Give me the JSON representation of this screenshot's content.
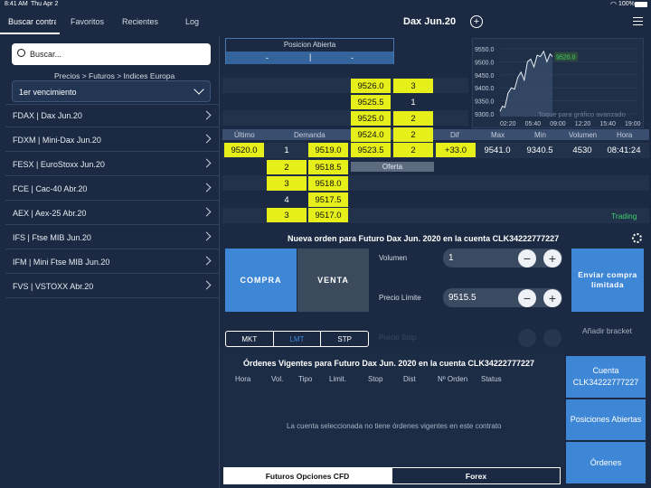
{
  "status": {
    "time": "8:41 AM",
    "date": "Thu Apr 2",
    "battery": "100%"
  },
  "tabs": [
    {
      "label": "Buscar contrat"
    },
    {
      "label": "Favoritos"
    },
    {
      "label": "Recientes"
    },
    {
      "label": "Log"
    }
  ],
  "header": {
    "title": "Dax Jun.20"
  },
  "search": {
    "placeholder": "Buscar..."
  },
  "breadcrumb": "Precios > Futuros > Indices Europa",
  "expiry": {
    "selected": "1er vencimiento"
  },
  "contracts": [
    {
      "label": "FDAX | Dax Jun.20"
    },
    {
      "label": "FDXM | Mini-Dax Jun.20"
    },
    {
      "label": "FESX | EuroStoxx Jun.20"
    },
    {
      "label": "FCE | Cac-40 Abr.20"
    },
    {
      "label": "AEX | Aex-25 Abr.20"
    },
    {
      "label": "IFS | Ftse MIB Jun.20"
    },
    {
      "label": "IFM | Mini Ftse MIB Jun.20"
    },
    {
      "label": "FVS | VSTOXX Abr.20"
    }
  ],
  "position": {
    "title": "Posicion Abierta",
    "left": "-",
    "mid": "|",
    "right": "-"
  },
  "book": {
    "asks": [
      {
        "price": "9526.0",
        "qty": "3"
      },
      {
        "price": "9525.5",
        "qty": "1"
      },
      {
        "price": "9525.0",
        "qty": "2"
      },
      {
        "price": "9524.0",
        "qty": "2"
      },
      {
        "price": "9523.5",
        "qty": "2"
      }
    ],
    "bids": [
      {
        "qty": "1",
        "price": "9519.0"
      },
      {
        "qty": "2",
        "price": "9518.5"
      },
      {
        "qty": "3",
        "price": "9518.0"
      },
      {
        "qty": "4",
        "price": "9517.5"
      },
      {
        "qty": "3",
        "price": "9517.0"
      }
    ],
    "ask_label": "Oferta",
    "headers": {
      "ultimo": "Último",
      "demanda": "Demanda",
      "dif": "Dif",
      "max": "Max",
      "min": "Min",
      "volumen": "Volumen",
      "hora": "Hora"
    },
    "values": {
      "ultimo": "9520.0",
      "dif": "+33.0",
      "max": "9541.0",
      "min": "9340.5",
      "volumen": "4530",
      "hora": "08:41:24"
    },
    "status": "Trading"
  },
  "chart_data": {
    "type": "line",
    "x_ticks": [
      "02:20",
      "05:40",
      "09:00",
      "12:20",
      "15:40",
      "19:00"
    ],
    "y_ticks": [
      "9550.0",
      "9500.0",
      "9450.0",
      "9400.0",
      "9350.0",
      "9300.0"
    ],
    "ylim": [
      9290,
      9560
    ],
    "x": [
      0,
      0.3,
      0.6,
      1,
      1.4,
      1.8,
      2.2,
      2.6,
      3,
      3.4,
      3.8,
      4.2,
      4.6,
      5,
      5.4,
      5.8,
      6.2,
      6.5
    ],
    "y": [
      9310,
      9330,
      9325,
      9380,
      9400,
      9395,
      9440,
      9460,
      9430,
      9500,
      9510,
      9480,
      9525,
      9520,
      9540,
      9500,
      9530,
      9520
    ],
    "xlim": [
      0,
      17
    ],
    "last_label": "9520.0",
    "overlay": "Toque para gráfico avanzado"
  },
  "order": {
    "title": "Nueva orden para Futuro Dax Jun. 2020 en la cuenta CLK34222777227",
    "buy": "COMPRA",
    "sell": "VENTA",
    "volume_label": "Volumen",
    "volume": "1",
    "price_label": "Precio Límite",
    "price": "9515.5",
    "submit": "Enviar compra limitada",
    "types": [
      "MKT",
      "LMT",
      "STP"
    ],
    "stop_label": "Precio Stop",
    "bracket": "Añadir bracket"
  },
  "orders": {
    "title": "Órdenes Vigentes para Futuro Dax Jun. 2020 en la cuenta CLK34222777227",
    "cols": [
      "Hora",
      "Vol.",
      "Tipo",
      "Limit.",
      "Stop",
      "Dist",
      "Nº Orden",
      "Status"
    ],
    "empty": "La cuenta seleccionada no tiene órdenes vigentes en este contrato"
  },
  "right_buttons": {
    "account": "Cuenta CLK34222777227",
    "positions": "Posiciones Abiertas",
    "orders": "Órdenes"
  },
  "bottom_tabs": [
    "Futuros Opciones CFD",
    "Forex"
  ],
  "colors": {
    "accent": "#3e86d6",
    "highlight": "#e6ef1a",
    "bg": "#1b2a42",
    "green": "#3ecf6c"
  }
}
